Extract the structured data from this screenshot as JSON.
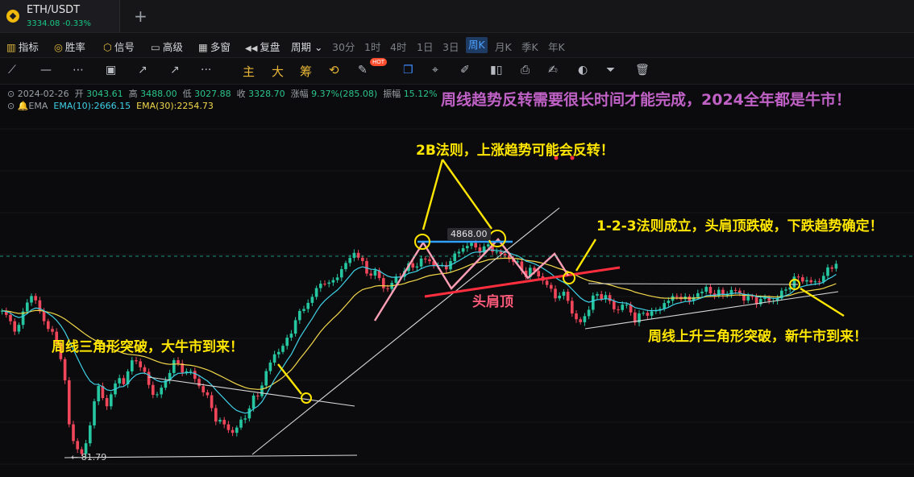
{
  "tab": {
    "symbol": "ETH/USDT",
    "price": "3334.08",
    "change": "-0.33%"
  },
  "toolbar1": [
    {
      "icon": "▥",
      "label": "指标"
    },
    {
      "icon": "◎",
      "label": "胜率"
    },
    {
      "icon": "⬡",
      "label": "信号"
    },
    {
      "icon": "▭",
      "label": "高级"
    },
    {
      "icon": "▦",
      "label": "多窗"
    },
    {
      "icon": "◀◀",
      "label": "复盘"
    },
    {
      "icon": "",
      "label": "周期 ⌄"
    }
  ],
  "timeframes": [
    "30分",
    "1时",
    "4时",
    "1日",
    "3日",
    "周K",
    "月K",
    "季K",
    "年K"
  ],
  "active_timeframe": "周K",
  "toolbar2_zh": [
    "主",
    "大",
    "筹"
  ],
  "hot_badge": "HOT",
  "ohlc": {
    "date": "2024-02-26",
    "open_label": "开",
    "open": "3043.61",
    "high_label": "高",
    "high": "3488.00",
    "low_label": "低",
    "low": "3027.88",
    "close_label": "收",
    "close": "3328.70",
    "chg_label": "涨幅",
    "chg": "9.37%(285.08)",
    "amp_label": "振幅",
    "amp": "15.12%"
  },
  "ema": {
    "label": "EMA",
    "ema10": "EMA(10):2666.15",
    "ema30": "EMA(30):2254.73"
  },
  "headline": "周线趋势反转需要很长时间才能完成，2024全年都是牛市！",
  "annotations": {
    "twob": "2B法则，上涨趋势可能会反转！",
    "rule123": "1-2-3法则成立，头肩顶跌破，下跌趋势确定！",
    "head_shoulders": "头肩顶",
    "triangle1": "周线三角形突破，大牛市到来！",
    "triangle2": "周线上升三角形突破，新牛市到来！",
    "high_price": "4868.00",
    "low_price": "← 81.79"
  },
  "colors": {
    "up": "#26c6a0",
    "down": "#f0465a",
    "ema10": "#3fd1e6",
    "ema30": "#f3d84a",
    "accent": "#ffe600",
    "head_shoulders": "#ff7ea0",
    "neckline": "#ff2e3e"
  },
  "chart_data": {
    "type": "candlestick",
    "symbol": "ETH/USDT",
    "interval": "1W",
    "ylim": [
      40,
      5900
    ],
    "y": [
      1300,
      1120,
      930,
      980,
      1600,
      1760,
      1350,
      1050,
      880,
      690,
      490,
      145,
      100,
      82,
      105,
      230,
      300,
      210,
      260,
      370,
      330,
      450,
      530,
      420,
      330,
      250,
      280,
      350,
      500,
      450,
      410,
      400,
      330,
      285,
      230,
      170,
      150,
      140,
      125,
      150,
      175,
      230,
      260,
      360,
      470,
      600,
      640,
      760,
      1060,
      1250,
      1480,
      1720,
      2080,
      2340,
      2060,
      2590,
      2950,
      3450,
      4150,
      3320,
      2610,
      2800,
      2380,
      1900,
      2190,
      2480,
      2830,
      3050,
      3080,
      3500,
      3380,
      3230,
      2920,
      3090,
      3500,
      4100,
      4470,
      4620,
      4280,
      4180,
      4540,
      4060,
      3760,
      3680,
      3400,
      3000,
      2610,
      2880,
      2610,
      2280,
      1940,
      1720,
      1790,
      1620,
      1100,
      1030,
      1240,
      1680,
      1720,
      1790,
      1440,
      1300,
      1500,
      1330,
      1100,
      1210,
      1250,
      1280,
      1300,
      1640,
      1580,
      1780,
      1640,
      1550,
      1850,
      1840,
      2040,
      1740,
      1850,
      1800,
      1920,
      1840,
      1640,
      1660,
      1580,
      1620,
      1600,
      1590,
      1810,
      2040,
      2340,
      2460,
      2330,
      2190,
      2280,
      2600,
      2890,
      3330
    ]
  }
}
